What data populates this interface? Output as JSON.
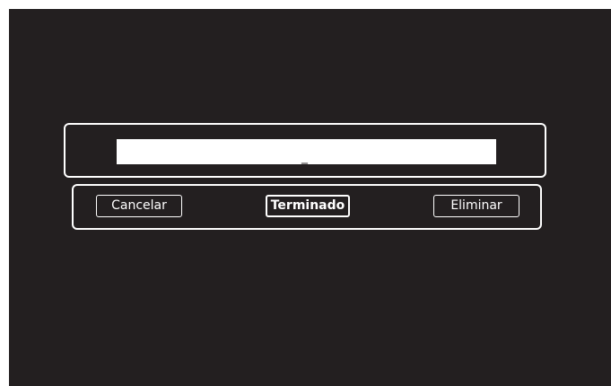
{
  "dialog": {
    "input": {
      "value": "_"
    },
    "buttons": {
      "cancel": "Cancelar",
      "done": "Terminado",
      "delete": "Eliminar"
    }
  },
  "colors": {
    "background": "#231f20",
    "frame": "#ffffff",
    "field": "#ffffff",
    "text": "#ffffff"
  }
}
